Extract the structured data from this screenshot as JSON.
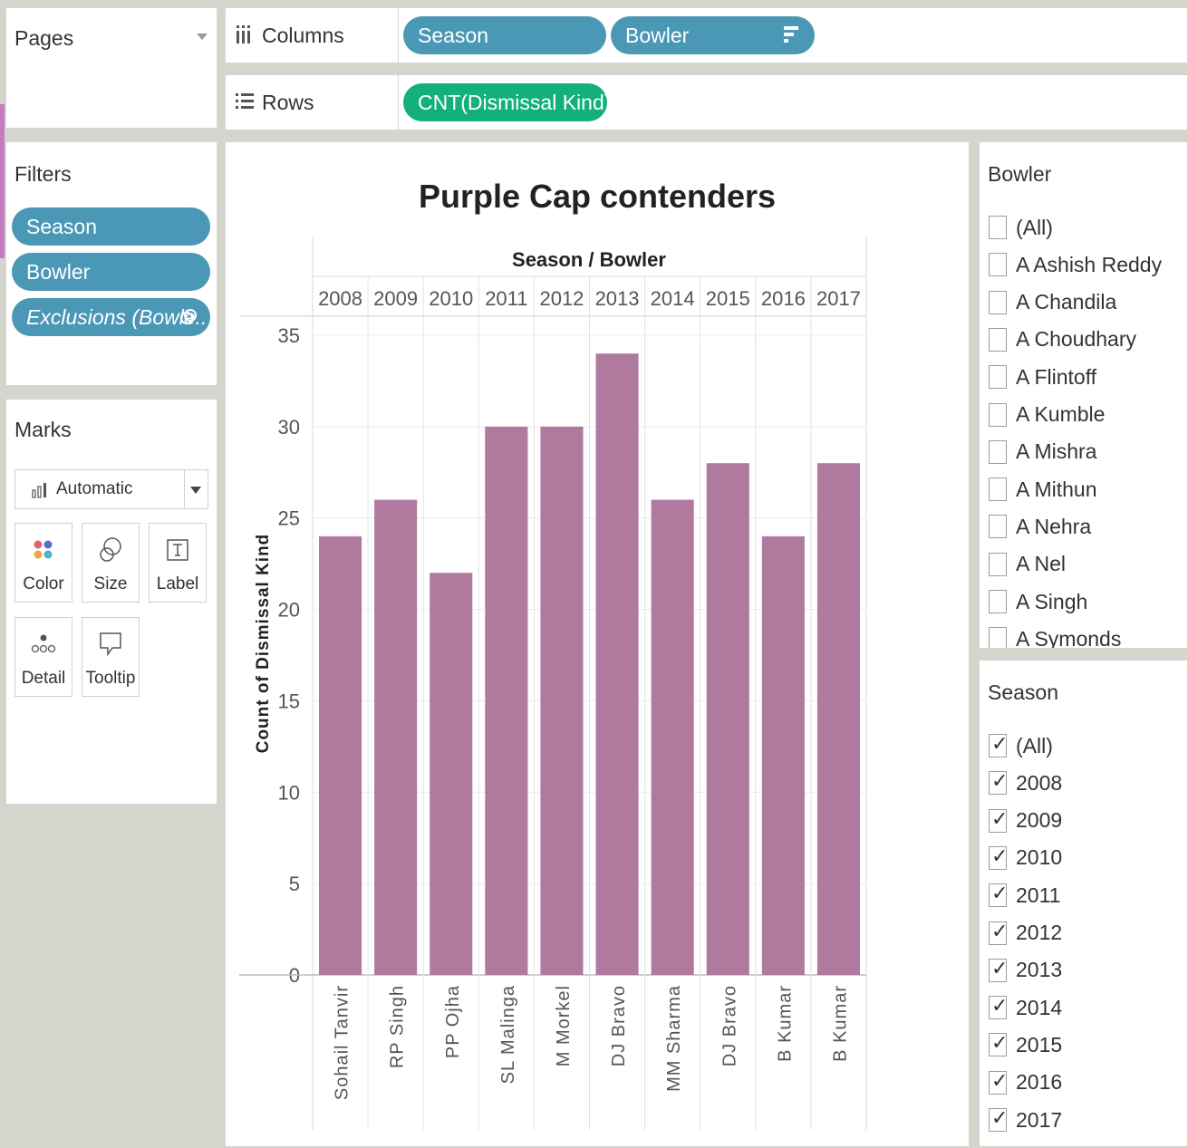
{
  "pages_card": {
    "title": "Pages"
  },
  "columns_shelf": {
    "label": "Columns",
    "pills": [
      "Season",
      "Bowler"
    ]
  },
  "rows_shelf": {
    "label": "Rows",
    "pills": [
      "CNT(Dismissal Kind)"
    ]
  },
  "filters_card": {
    "title": "Filters",
    "pills": [
      "Season",
      "Bowler",
      "Exclusions (Bowle.."
    ]
  },
  "marks_card": {
    "title": "Marks",
    "mark_type": "Automatic",
    "buttons": [
      "Color",
      "Size",
      "Label",
      "Detail",
      "Tooltip"
    ]
  },
  "bowler_filter": {
    "title": "Bowler",
    "items": [
      "(All)",
      "A Ashish Reddy",
      "A Chandila",
      "A Choudhary",
      "A Flintoff",
      "A Kumble",
      "A Mishra",
      "A Mithun",
      "A Nehra",
      "A Nel",
      "A Singh",
      "A Symonds"
    ]
  },
  "season_filter": {
    "title": "Season",
    "items": [
      "(All)",
      "2008",
      "2009",
      "2010",
      "2011",
      "2012",
      "2013",
      "2014",
      "2015",
      "2016",
      "2017"
    ]
  },
  "colors": {
    "bar": "#b07a9f",
    "pill_blue": "#4a98b6",
    "pill_green": "#13b07a"
  },
  "chart_data": {
    "type": "bar",
    "title": "Purple Cap contenders",
    "header": "Season / Bowler",
    "ylabel": "Count of Dismissal Kind",
    "seasons": [
      "2008",
      "2009",
      "2010",
      "2011",
      "2012",
      "2013",
      "2014",
      "2015",
      "2016",
      "2017"
    ],
    "categories": [
      "Sohail Tanvir",
      "RP Singh",
      "PP Ojha",
      "SL Malinga",
      "M Morkel",
      "DJ Bravo",
      "MM Sharma",
      "DJ Bravo",
      "B Kumar",
      "B Kumar"
    ],
    "values": [
      24,
      26,
      22,
      30,
      30,
      34,
      26,
      28,
      24,
      28
    ],
    "yticks": [
      0,
      5,
      10,
      15,
      20,
      25,
      30,
      35
    ],
    "ylim": [
      0,
      35
    ],
    "grid": true
  }
}
